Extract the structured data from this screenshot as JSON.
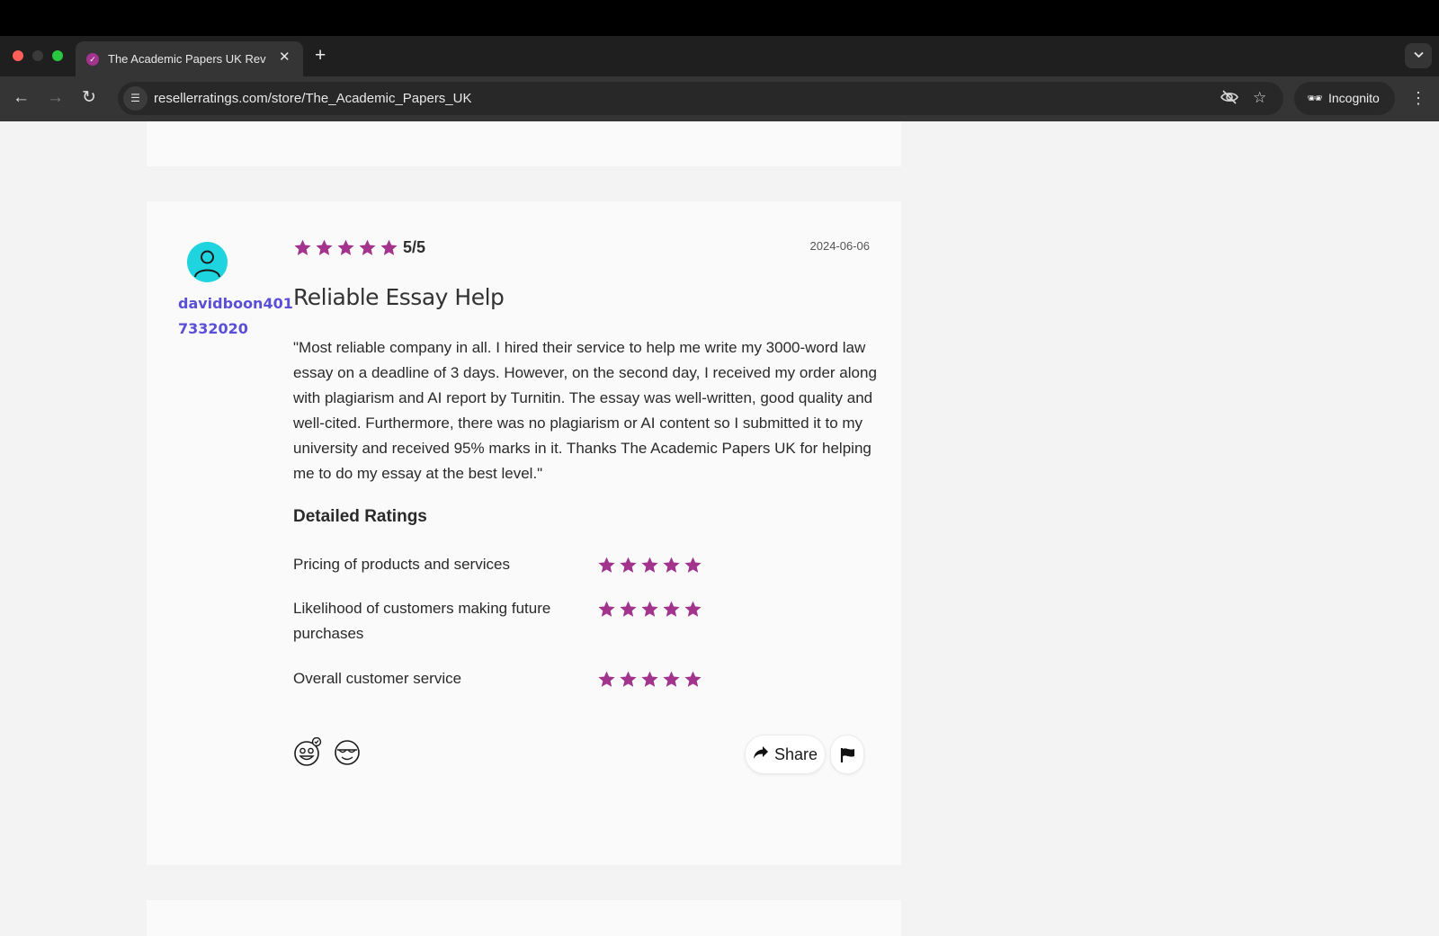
{
  "browser": {
    "tab_title": "The Academic Papers UK Rev",
    "tab_close": "✕",
    "new_tab": "+",
    "tab_list": "⌄",
    "url": "resellerratings.com/store/The_Academic_Papers_UK",
    "incognito_label": "Incognito",
    "icons": [
      "back-icon",
      "forward-icon",
      "reload-icon",
      "site-info-icon",
      "eye-off-icon",
      "star-bookmark-icon",
      "incognito-icon",
      "menu-icon"
    ]
  },
  "review": {
    "username": "davidboon4017332020",
    "rating_stars": 5,
    "score": "5/5",
    "date": "2024-06-06",
    "title": "Reliable Essay Help",
    "body": "\"Most reliable company in all. I hired their service to help me write my 3000-word law essay on a deadline of 3 days. However, on the second day, I received my order along with plagiarism and AI report by Turnitin. The essay was well-written, good quality and well-cited. Furthermore, there was no plagiarism or AI content so I submitted it to my university and received 95% marks in it. Thanks The Academic Papers UK for helping me to do my essay at the best level.\"",
    "detailed_ratings_title": "Detailed Ratings",
    "detailed_ratings": [
      {
        "label": "Pricing of products and services",
        "stars": 5
      },
      {
        "label": "Likelihood of customers making future purchases",
        "stars": 5
      },
      {
        "label": "Overall customer service",
        "stars": 5
      }
    ],
    "share_label": "Share"
  },
  "colors": {
    "star": "#a3348e",
    "username": "#5a4fd6",
    "avatar": "#1ed4de"
  }
}
